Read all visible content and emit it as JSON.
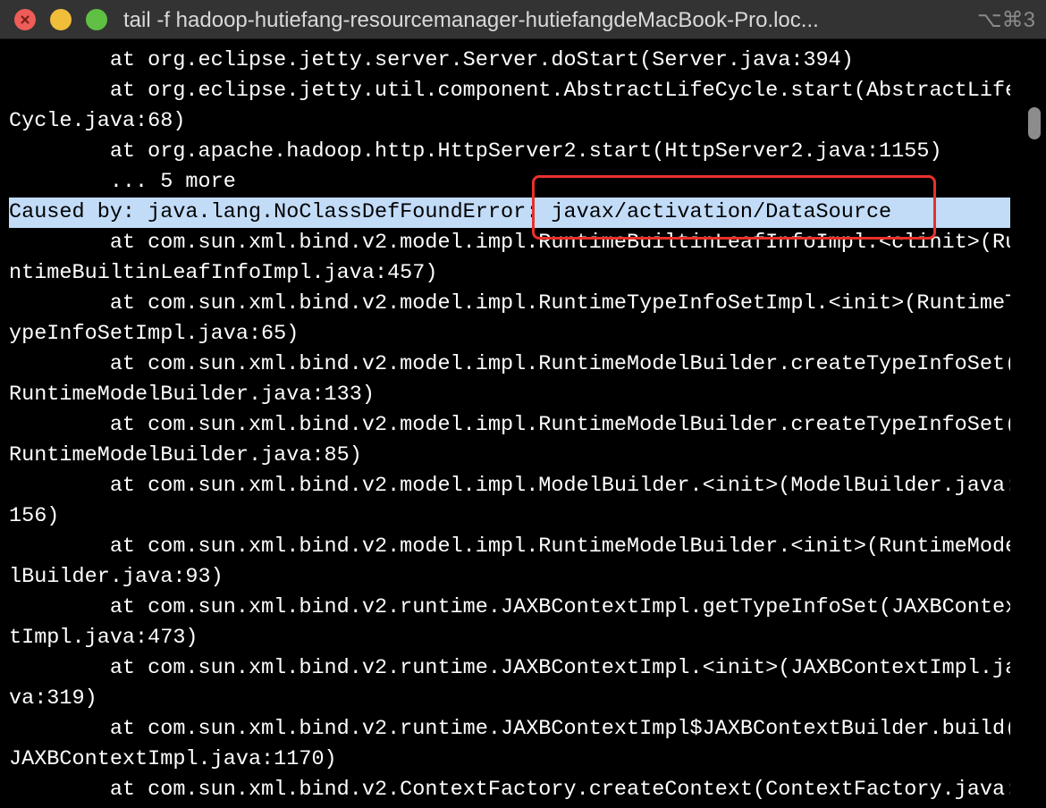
{
  "window": {
    "title": "tail -f hadoop-hutiefang-resourcemanager-hutiefangdeMacBook-Pro.loc...",
    "shortcut": "⌥⌘3",
    "controls": [
      "close-icon",
      "minimize-icon",
      "maximize-icon"
    ]
  },
  "terminal": {
    "lines": [
      "        at org.eclipse.jetty.server.Server.doStart(Server.java:394)",
      "        at org.eclipse.jetty.util.component.AbstractLifeCycle.start(AbstractLife",
      "Cycle.java:68)",
      "        at org.apache.hadoop.http.HttpServer2.start(HttpServer2.java:1155)",
      "        ... 5 more",
      "Caused by: java.lang.NoClassDefFoundError: javax/activation/DataSource",
      "        at com.sun.xml.bind.v2.model.impl.RuntimeBuiltinLeafInfoImpl.<clinit>(Ru",
      "ntimeBuiltinLeafInfoImpl.java:457)",
      "        at com.sun.xml.bind.v2.model.impl.RuntimeTypeInfoSetImpl.<init>(RuntimeT",
      "ypeInfoSetImpl.java:65)",
      "        at com.sun.xml.bind.v2.model.impl.RuntimeModelBuilder.createTypeInfoSet(",
      "RuntimeModelBuilder.java:133)",
      "        at com.sun.xml.bind.v2.model.impl.RuntimeModelBuilder.createTypeInfoSet(",
      "RuntimeModelBuilder.java:85)",
      "        at com.sun.xml.bind.v2.model.impl.ModelBuilder.<init>(ModelBuilder.java:",
      "156)",
      "        at com.sun.xml.bind.v2.model.impl.RuntimeModelBuilder.<init>(RuntimeMode",
      "lBuilder.java:93)",
      "        at com.sun.xml.bind.v2.runtime.JAXBContextImpl.getTypeInfoSet(JAXBContex",
      "tImpl.java:473)",
      "        at com.sun.xml.bind.v2.runtime.JAXBContextImpl.<init>(JAXBContextImpl.ja",
      "va:319)",
      "        at com.sun.xml.bind.v2.runtime.JAXBContextImpl$JAXBContextBuilder.build(",
      "JAXBContextImpl.java:1170)",
      "        at com.sun.xml.bind.v2.ContextFactory.createContext(ContextFactory.java:"
    ],
    "highlighted_line_index": 5,
    "selection_color": "#c2dcf8",
    "annotation_color": "#e8302a"
  },
  "colors": {
    "titlebar": "#333333",
    "background": "#000000",
    "text": "#ffffff",
    "close": "#ee5d57",
    "minimize": "#f1be3a",
    "maximize": "#5fc043"
  }
}
